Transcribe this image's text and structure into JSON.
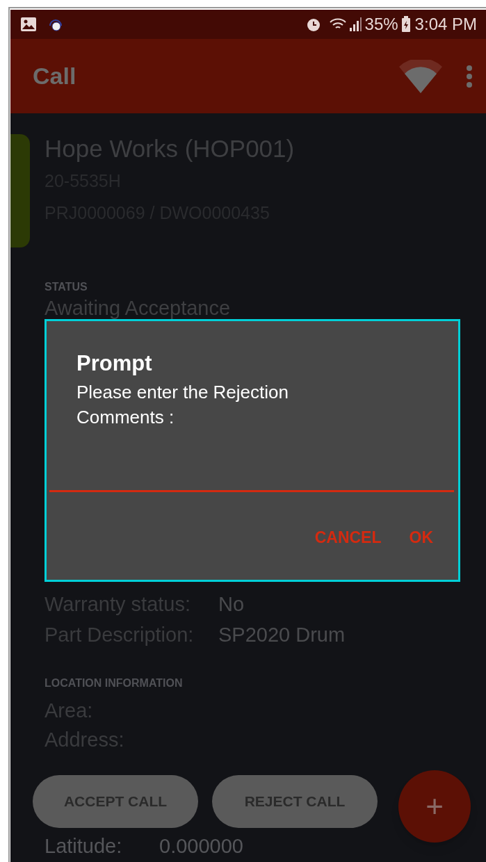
{
  "status_bar": {
    "battery": "35%",
    "time": "3:04 PM"
  },
  "app_bar": {
    "title": "Call"
  },
  "call": {
    "title": "Hope Works (HOP001)",
    "lines": [
      "20-5535H",
      "PRJ0000069 / DWO0000435"
    ],
    "color": "#2c3a05"
  },
  "status": {
    "heading": "STATUS",
    "value": "Awaiting Acceptance"
  },
  "details": [
    {
      "label": "Warranty status:",
      "value": "No"
    },
    {
      "label": "Part Description:",
      "value": "SP2020 Drum"
    }
  ],
  "location": {
    "heading": "LOCATION INFORMATION",
    "rows": [
      {
        "label": "Area:"
      },
      {
        "label": "Address:"
      }
    ],
    "latitude": {
      "label": "Latitude:",
      "value": "0.000000"
    }
  },
  "actions": [
    "ACCEPT CALL",
    "REJECT CALL"
  ],
  "fab": "+",
  "dialog": {
    "title": "Prompt",
    "message": "Please enter the Rejection Comments :",
    "buttons": [
      "CANCEL",
      "OK"
    ]
  }
}
